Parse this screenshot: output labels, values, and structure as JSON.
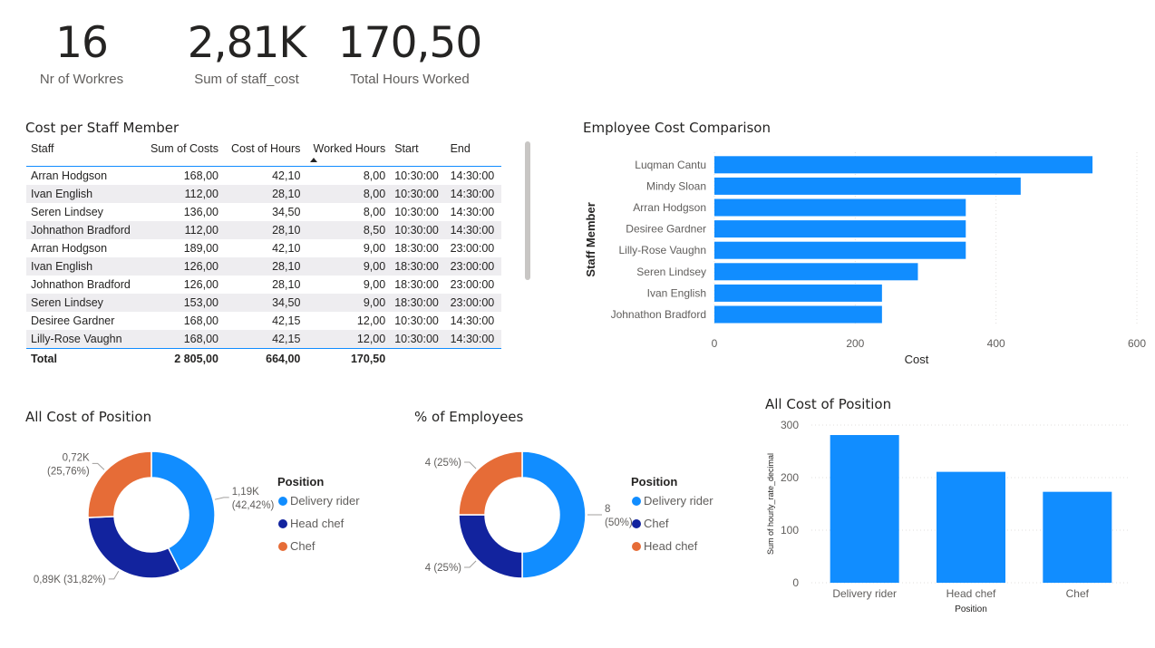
{
  "kpis": [
    {
      "value": "16",
      "label": "Nr of Workres"
    },
    {
      "value": "2,81K",
      "label": "Sum of staff_cost"
    },
    {
      "value": "170,50",
      "label": "Total Hours Worked"
    }
  ],
  "table": {
    "title": "Cost per Staff Member",
    "columns": [
      "Staff",
      "Sum of Costs",
      "Cost of Hours",
      "Worked Hours",
      "Start",
      "End"
    ],
    "rows": [
      [
        "Arran Hodgson",
        "168,00",
        "42,10",
        "8,00",
        "10:30:00",
        "14:30:00"
      ],
      [
        "Ivan English",
        "112,00",
        "28,10",
        "8,00",
        "10:30:00",
        "14:30:00"
      ],
      [
        "Seren Lindsey",
        "136,00",
        "34,50",
        "8,00",
        "10:30:00",
        "14:30:00"
      ],
      [
        "Johnathon Bradford",
        "112,00",
        "28,10",
        "8,50",
        "10:30:00",
        "14:30:00"
      ],
      [
        "Arran Hodgson",
        "189,00",
        "42,10",
        "9,00",
        "18:30:00",
        "23:00:00"
      ],
      [
        "Ivan English",
        "126,00",
        "28,10",
        "9,00",
        "18:30:00",
        "23:00:00"
      ],
      [
        "Johnathon Bradford",
        "126,00",
        "28,10",
        "9,00",
        "18:30:00",
        "23:00:00"
      ],
      [
        "Seren Lindsey",
        "153,00",
        "34,50",
        "9,00",
        "18:30:00",
        "23:00:00"
      ],
      [
        "Desiree Gardner",
        "168,00",
        "42,15",
        "12,00",
        "10:30:00",
        "14:30:00"
      ],
      [
        "Lilly-Rose Vaughn",
        "168,00",
        "42,15",
        "12,00",
        "10:30:00",
        "14:30:00"
      ]
    ],
    "total": [
      "Total",
      "2 805,00",
      "664,00",
      "170,50",
      "",
      ""
    ]
  },
  "colors": {
    "blue": "#118dff",
    "dark_blue": "#12239e",
    "orange": "#e66c37",
    "text": "#252423",
    "subtle_text": "#605e5c",
    "gridline": "#e1dfdd"
  },
  "chart_data": [
    {
      "type": "bar",
      "orientation": "horizontal",
      "title": "Employee Cost Comparison",
      "xlabel": "Cost",
      "ylabel": "Staff Member",
      "categories": [
        "Luqman Cantu",
        "Mindy Sloan",
        "Arran Hodgson",
        "Desiree Gardner",
        "Lilly-Rose Vaughn",
        "Seren Lindsey",
        "Ivan English",
        "Johnathon Bradford"
      ],
      "values": [
        537,
        435,
        357,
        357,
        357,
        289,
        238,
        238
      ],
      "ticks": [
        "0",
        "200",
        "400",
        "600"
      ],
      "xlim": [
        0,
        600
      ],
      "grid": true
    },
    {
      "type": "pie",
      "variant": "donut",
      "title": "All Cost of Position",
      "legend_title": "Position",
      "legend_position": "right",
      "slices": [
        {
          "name": "Delivery rider",
          "value": 1.19,
          "percent": 42.42,
          "label": "1,19K\n(42,42%)"
        },
        {
          "name": "Head chef",
          "value": 0.89,
          "percent": 31.82,
          "label": "0,89K (31,82%)"
        },
        {
          "name": "Chef",
          "value": 0.72,
          "percent": 25.76,
          "label": "0,72K\n(25,76%)"
        }
      ]
    },
    {
      "type": "pie",
      "variant": "donut",
      "title": "% of Employees",
      "legend_title": "Position",
      "legend_position": "right",
      "slices": [
        {
          "name": "Delivery rider",
          "value": 8,
          "percent": 50,
          "label": "8\n(50%)"
        },
        {
          "name": "Chef",
          "value": 4,
          "percent": 25,
          "label": "4 (25%)"
        },
        {
          "name": "Head chef",
          "value": 4,
          "percent": 25,
          "label": "4 (25%)"
        }
      ]
    },
    {
      "type": "bar",
      "orientation": "vertical",
      "title": "All Cost of Position",
      "xlabel": "Position",
      "ylabel": "Sum of hourly_rate_decimal",
      "categories": [
        "Delivery rider",
        "Head chef",
        "Chef"
      ],
      "values": [
        281,
        211,
        173
      ],
      "ticks": [
        "0",
        "100",
        "200",
        "300"
      ],
      "ylim": [
        0,
        300
      ],
      "grid": true
    }
  ]
}
